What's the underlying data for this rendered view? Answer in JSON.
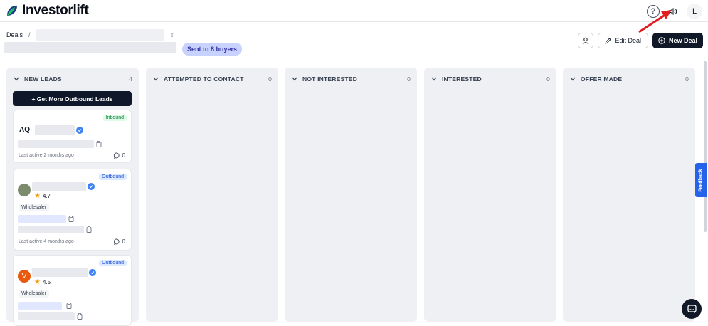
{
  "app": {
    "name": "Investorlift"
  },
  "topbar": {
    "avatar_initial": "L",
    "help_symbol": "?"
  },
  "breadcrumb": {
    "root": "Deals",
    "separator": "/"
  },
  "deal": {
    "sent_badge": "Sent to 8 buyers"
  },
  "actions": {
    "edit_label": "Edit Deal",
    "new_label": "New Deal"
  },
  "columns": [
    {
      "title": "NEW LEADS",
      "count": "4"
    },
    {
      "title": "ATTEMPTED TO CONTACT",
      "count": "0"
    },
    {
      "title": "NOT INTERESTED",
      "count": "0"
    },
    {
      "title": "INTERESTED",
      "count": "0"
    },
    {
      "title": "OFFER MADE",
      "count": "0"
    }
  ],
  "new_leads": {
    "outbound_button": "+ Get More Outbound Leads",
    "cards": [
      {
        "badge": "Inbound",
        "initials": "AQ",
        "last_active": "Last active 2 months ago",
        "comments": "0"
      },
      {
        "badge": "Outbound",
        "rating": "4.7",
        "tag": "Wholesaler",
        "last_active": "Last active 4 months ago",
        "comments": "0"
      },
      {
        "badge": "Outbound",
        "initials": "V",
        "rating": "4.5",
        "tag": "Wholesaler"
      }
    ]
  },
  "feedback": {
    "label": "Feedback"
  },
  "colors": {
    "brand_dark": "#111827",
    "inbound": "#15803d",
    "outbound": "#1d4ed8",
    "feedback": "#2563eb"
  }
}
